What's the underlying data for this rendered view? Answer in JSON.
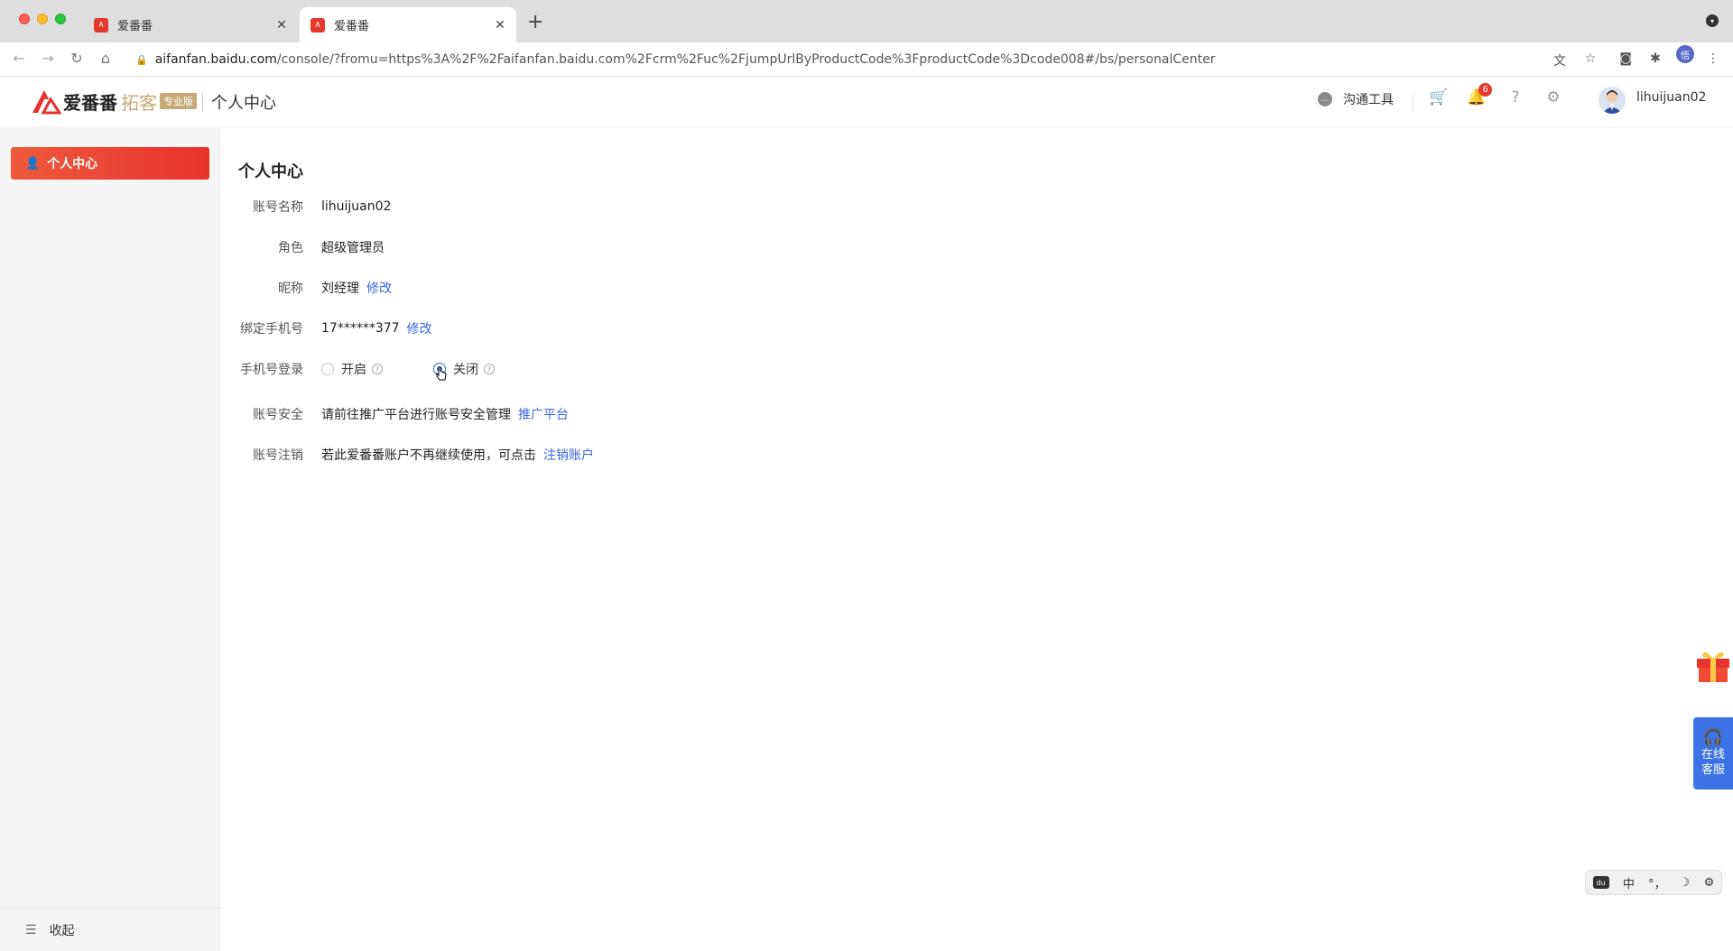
{
  "browser": {
    "tabs": [
      {
        "title": "爱番番"
      },
      {
        "title": "爱番番"
      }
    ],
    "url_host": "aifanfan.baidu.com",
    "url_path": "/console/?fromu=https%3A%2F%2Faifanfan.baidu.com%2Fcrm%2Fuc%2FjumpUrlByProductCode%3FproductCode%3Dcode008#/bs/personalCenter",
    "profile_initial": "悟"
  },
  "header": {
    "logo_text": "爱番番",
    "logo_sub": "拓客",
    "logo_badge": "专业版",
    "title": "个人中心",
    "comm_tool": "沟通工具",
    "notification_count": "6",
    "username": "lihuijuan02"
  },
  "sidebar": {
    "items": [
      {
        "label": "个人中心"
      }
    ],
    "collapse_label": "收起"
  },
  "main": {
    "title": "个人中心",
    "account_name": {
      "label": "账号名称",
      "value": "lihuijuan02"
    },
    "role": {
      "label": "角色",
      "value": "超级管理员"
    },
    "nickname": {
      "label": "昵称",
      "value": "刘经理",
      "action": "修改"
    },
    "phone": {
      "label": "绑定手机号",
      "value": "17******377",
      "action": "修改"
    },
    "phone_login": {
      "label": "手机号登录",
      "option_on": "开启",
      "option_off": "关闭",
      "selected": "关闭"
    },
    "security": {
      "label": "账号安全",
      "value": "请前往推广平台进行账号安全管理",
      "action": "推广平台"
    },
    "cancel": {
      "label": "账号注销",
      "value": "若此爱番番账户不再继续使用，可点击",
      "action": "注销账户"
    }
  },
  "widgets": {
    "customer_service": [
      "在线",
      "客服"
    ],
    "ime": {
      "lang": "中",
      "punct": "°，",
      "moon": "☽",
      "gear": "⚙"
    }
  },
  "colors": {
    "brand_red": "#e8322d",
    "link_blue": "#3866e0",
    "gold": "#c7a977"
  }
}
